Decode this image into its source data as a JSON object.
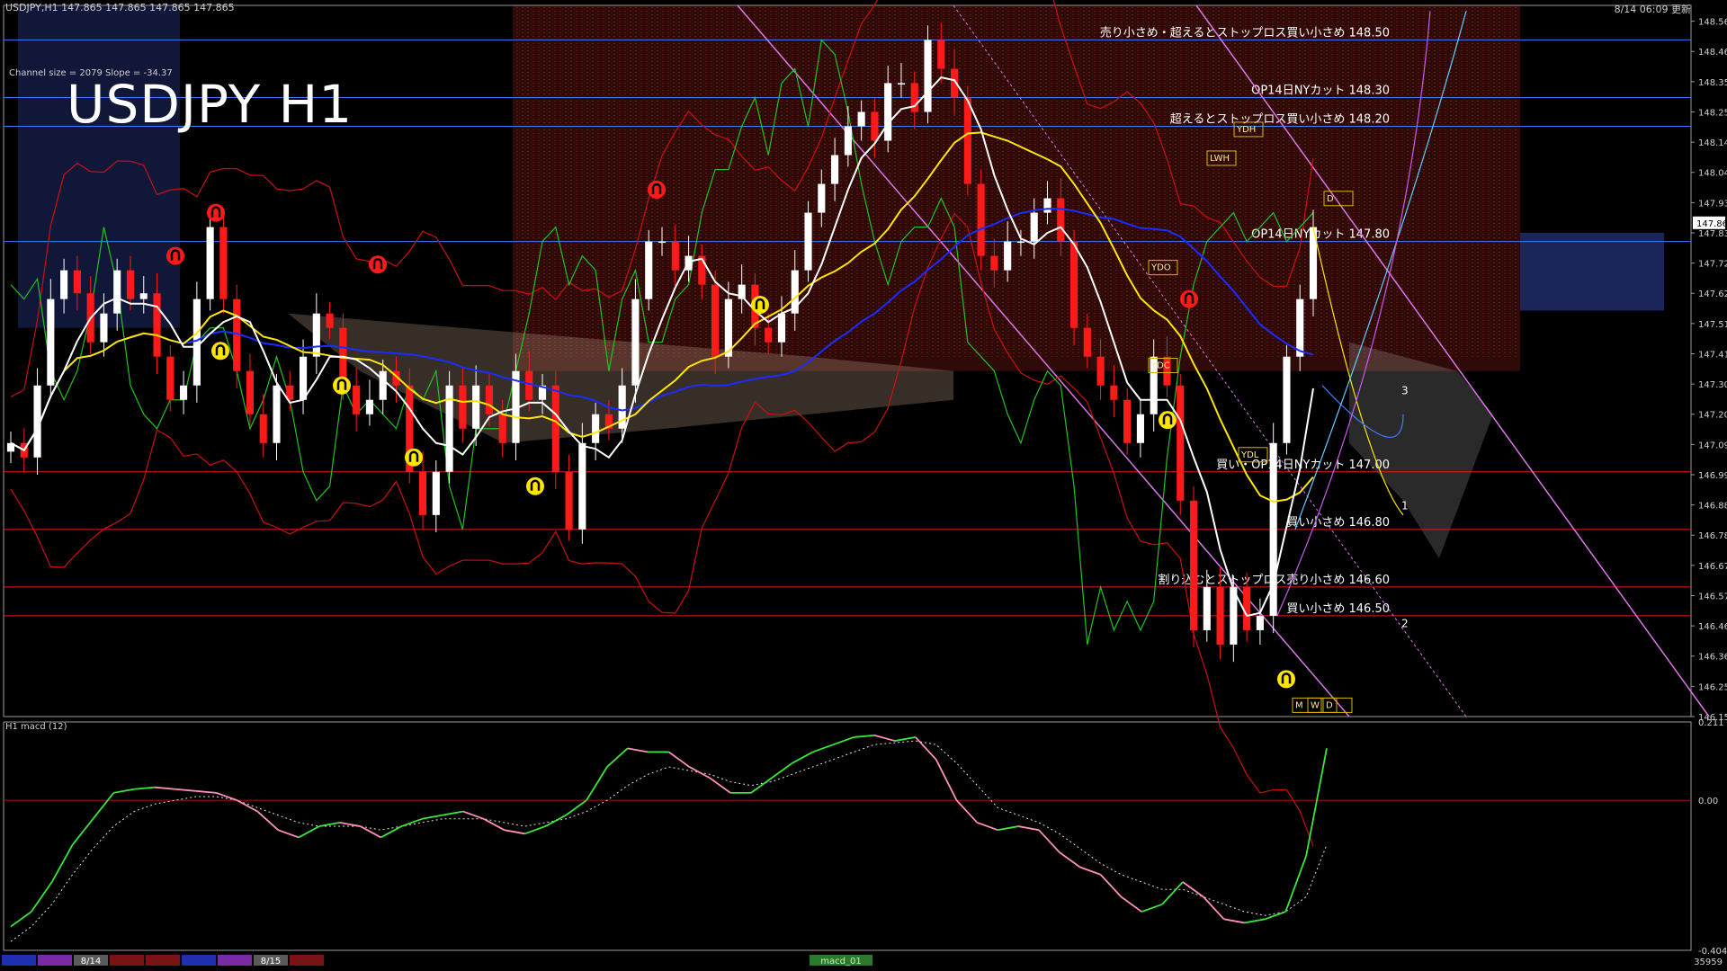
{
  "header": {
    "symbol_info": "USDJPY,H1  147.865 147.865 147.865 147.865",
    "timestamp": "8/14 06:09 更新",
    "big_title": "USDJPY H1",
    "channel_info": "Channel size = 2079  Slope = -34.37",
    "sub_title": "H1  macd (12)",
    "footer_right": "35959",
    "footer_tab": "macd_01"
  },
  "timeline_tabs": [
    "",
    "",
    "8/14",
    "",
    "",
    "",
    "",
    "8/15",
    ""
  ],
  "colors": {
    "background": "#000000",
    "bull_candle": "#ffffff",
    "bear_candle": "#ff1a1a",
    "cloud_red": "#ff3b2e",
    "cloud_blue": "#4d6bff",
    "ma_white": "#ffffff",
    "ma_yellow": "#ffe600",
    "ma_blue": "#1a2cff",
    "band_red": "#cc1010",
    "lagging_green": "#22c422",
    "level_line_red": "#e21b1b",
    "level_line_blue": "#3d7bff",
    "channel_magenta": "#d977e6",
    "macd_green": "#39e63a",
    "macd_pink": "#ff8fbf"
  },
  "chart_data": [
    {
      "type": "candlestick",
      "title": "USDJPY H1",
      "ylim": [
        146.15,
        148.62
      ],
      "y_ticks": [
        "148.565",
        "148.460",
        "148.355",
        "148.250",
        "148.145",
        "148.040",
        "147.935",
        "147.830",
        "147.725",
        "147.620",
        "147.515",
        "147.410",
        "147.305",
        "147.200",
        "147.095",
        "146.990",
        "146.885",
        "146.780",
        "146.675",
        "146.570",
        "146.465",
        "146.360",
        "146.255",
        "146.150"
      ],
      "current_price": "147.865",
      "price_path": [
        147.1,
        147.05,
        147.3,
        147.6,
        147.7,
        147.62,
        147.45,
        147.55,
        147.7,
        147.6,
        147.62,
        147.4,
        147.25,
        147.3,
        147.6,
        147.85,
        147.6,
        147.35,
        147.2,
        147.1,
        147.3,
        147.25,
        147.4,
        147.55,
        147.5,
        147.3,
        147.2,
        147.25,
        147.35,
        147.3,
        147.0,
        146.85,
        147.0,
        147.3,
        147.15,
        147.3,
        147.2,
        147.1,
        147.35,
        147.25,
        147.3,
        147.0,
        146.8,
        147.1,
        147.2,
        147.15,
        147.3,
        147.6,
        147.8,
        147.8,
        147.7,
        147.75,
        147.65,
        147.4,
        147.6,
        147.65,
        147.5,
        147.45,
        147.55,
        147.7,
        147.9,
        148.0,
        148.1,
        148.2,
        148.25,
        148.15,
        148.35,
        148.35,
        148.25,
        148.5,
        148.4,
        148.3,
        148.0,
        147.75,
        147.7,
        147.8,
        147.8,
        147.9,
        147.95,
        147.8,
        147.5,
        147.4,
        147.3,
        147.25,
        147.1,
        147.2,
        147.4,
        147.3,
        146.9,
        146.45,
        146.6,
        146.4,
        146.6,
        146.45,
        146.5,
        147.1,
        147.4,
        147.6,
        147.85
      ],
      "levels": [
        {
          "price": 148.5,
          "label": "売り小さめ・超えるとストップロス買い小さめ 148.50",
          "color": "#3d7bff"
        },
        {
          "price": 148.3,
          "label": "OP14日NYカット 148.30",
          "color": "#3d7bff"
        },
        {
          "price": 148.2,
          "label": "超えるとストップロス買い小さめ 148.20",
          "color": "#3d7bff"
        },
        {
          "price": 147.8,
          "label": "OP14日NYカット 147.80",
          "color": "#3d7bff"
        },
        {
          "price": 147.0,
          "label": "買い・OP14日NYカット 147.00",
          "color": "#e21b1b"
        },
        {
          "price": 146.8,
          "label": "買い小さめ 146.80",
          "color": "#e21b1b"
        },
        {
          "price": 146.6,
          "label": "割り込むとストップロス売り小さめ 146.60",
          "color": "#e21b1b"
        },
        {
          "price": 146.5,
          "label": "買い小さめ 146.50",
          "color": "#e21b1b"
        }
      ],
      "box_labels": [
        "YDH",
        "LWH",
        "D",
        "YDO",
        "YDC",
        "YDL",
        "M",
        "W",
        "D"
      ],
      "wave_labels": [
        "1",
        "2",
        "3"
      ]
    },
    {
      "type": "line",
      "title": "H1  macd (12)",
      "ylim": [
        -0.404,
        0.211
      ],
      "y_ticks": [
        "0.211",
        "0.00",
        "-0.404"
      ],
      "series": [
        {
          "values": [
            -0.34,
            -0.3,
            -0.22,
            -0.12,
            -0.05,
            0.02,
            0.03,
            0.035,
            0.03,
            0.025,
            0.02,
            0.0,
            -0.03,
            -0.08,
            -0.1,
            -0.07,
            -0.06,
            -0.07,
            -0.1,
            -0.07,
            -0.05,
            -0.04,
            -0.03,
            -0.05,
            -0.08,
            -0.09,
            -0.07,
            -0.04,
            0.0,
            0.09,
            0.14,
            0.13,
            0.13,
            0.09,
            0.06,
            0.02,
            0.02,
            0.06,
            0.1,
            0.13,
            0.15,
            0.17,
            0.175,
            0.16,
            0.17,
            0.11,
            0.0,
            -0.06,
            -0.08,
            -0.07,
            -0.08,
            -0.14,
            -0.18,
            -0.2,
            -0.26,
            -0.3,
            -0.28,
            -0.22,
            -0.26,
            -0.32,
            -0.33,
            -0.32,
            -0.3,
            -0.15,
            0.14
          ]
        },
        {
          "values": [
            -0.38,
            -0.34,
            -0.28,
            -0.2,
            -0.13,
            -0.07,
            -0.03,
            -0.01,
            0.0,
            0.01,
            0.01,
            0.0,
            -0.02,
            -0.04,
            -0.06,
            -0.07,
            -0.07,
            -0.07,
            -0.08,
            -0.07,
            -0.06,
            -0.05,
            -0.05,
            -0.05,
            -0.06,
            -0.07,
            -0.06,
            -0.05,
            -0.03,
            0.0,
            0.04,
            0.07,
            0.09,
            0.08,
            0.07,
            0.05,
            0.04,
            0.05,
            0.07,
            0.09,
            0.11,
            0.13,
            0.15,
            0.155,
            0.16,
            0.15,
            0.1,
            0.04,
            -0.02,
            -0.04,
            -0.06,
            -0.09,
            -0.13,
            -0.17,
            -0.2,
            -0.22,
            -0.24,
            -0.24,
            -0.26,
            -0.28,
            -0.3,
            -0.31,
            -0.3,
            -0.26,
            -0.12
          ]
        }
      ]
    }
  ]
}
